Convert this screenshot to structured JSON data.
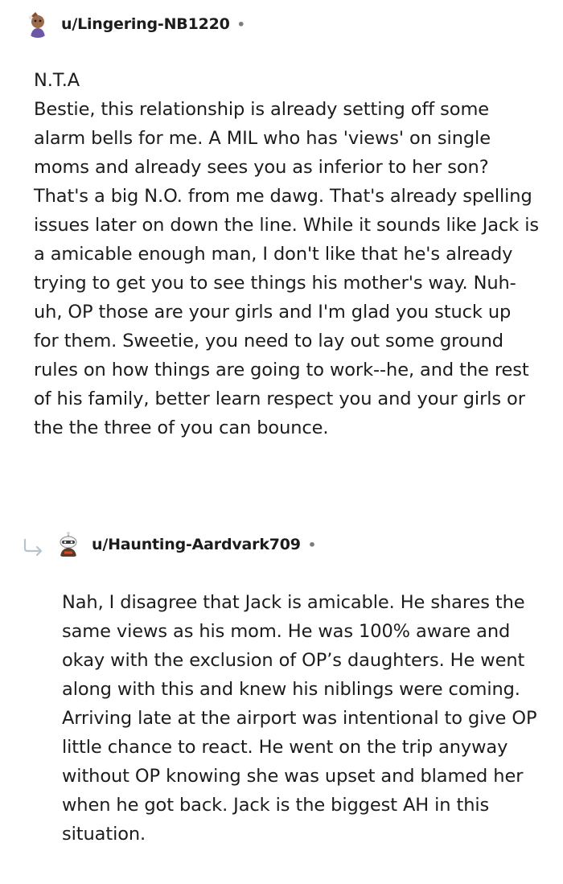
{
  "comments": [
    {
      "username": "u/Lingering-NB1220",
      "separator": "•",
      "verdict": "N.T.A",
      "body": "Bestie, this relationship is already setting off some alarm bells for me. A MIL who has 'views' on single moms and already sees you as inferior to her son? That's a big N.O. from me dawg. That's already spelling issues later on down the line. While it sounds like Jack is a amicable enough man, I don't like that he's already trying to get you to see things his mother's way. Nuh-uh, OP those are your girls and I'm glad you stuck up for them. Sweetie, you need to lay out some ground rules on how things are going to work--he, and the rest of his family, better learn respect you and your girls or the the three of you can bounce."
    },
    {
      "username": "u/Haunting-Aardvark709",
      "separator": "•",
      "body": "Nah, I disagree that Jack is amicable. He shares the same views as his mom. He was 100% aware and okay with the exclusion of OP’s daughters. He went along with this and knew his niblings were coming. Arriving late at the airport was intentional to give OP little chance to react. He went on the trip anyway without OP knowing she was upset and blamed her when he got back. Jack is the biggest AH in this situation."
    }
  ],
  "icons": {
    "avatar_1": "user-avatar-icon",
    "avatar_2": "user-avatar-icon",
    "reply_indicator": "reply-arrow-icon"
  },
  "colors": {
    "text": "#1c1c1c",
    "meta": "#7c7c7c",
    "reply_arrow": "#b8c4cc"
  }
}
